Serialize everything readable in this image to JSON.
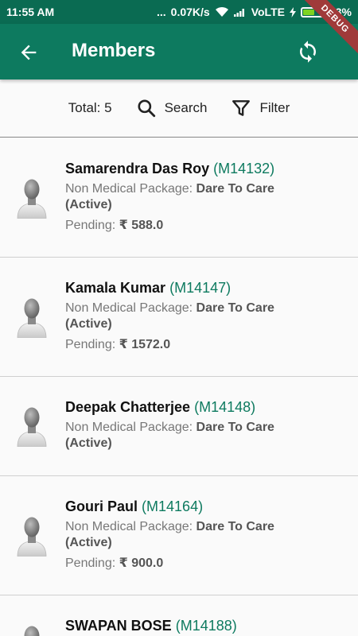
{
  "status_bar": {
    "time": "11:55 AM",
    "dots": "...",
    "speed": "0.07K/s",
    "network": "VoLTE",
    "battery": "53%",
    "battery_level": 0.53
  },
  "debug_ribbon": "DEBUG",
  "app_bar": {
    "title": "Members"
  },
  "toolbar": {
    "total": "Total: 5",
    "search_label": "Search",
    "filter_label": "Filter"
  },
  "members": [
    {
      "name": "Samarendra Das Roy",
      "id": "(M14132)",
      "package_label": "Non Medical Package:",
      "package_name": "Dare To Care",
      "status": "(Active)",
      "pending_label": "Pending:",
      "pending_amount": "₹ 588.0"
    },
    {
      "name": "Kamala Kumar",
      "id": "(M14147)",
      "package_label": "Non Medical Package:",
      "package_name": "Dare To Care",
      "status": "(Active)",
      "pending_label": "Pending:",
      "pending_amount": "₹ 1572.0"
    },
    {
      "name": "Deepak Chatterjee",
      "id": "(M14148)",
      "package_label": "Non Medical Package:",
      "package_name": "Dare To Care",
      "status": "(Active)"
    },
    {
      "name": "Gouri Paul",
      "id": "(M14164)",
      "package_label": "Non Medical Package:",
      "package_name": "Dare To Care",
      "status": "(Active)",
      "pending_label": "Pending:",
      "pending_amount": "₹ 900.0"
    },
    {
      "name": "SWAPAN BOSE",
      "id": "(M14188)"
    }
  ]
}
